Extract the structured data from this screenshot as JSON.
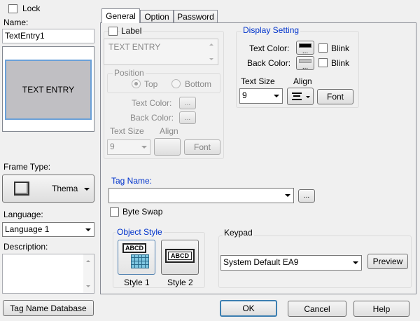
{
  "left": {
    "lock_label": "Lock",
    "name_label": "Name:",
    "name_value": "TextEntry1",
    "preview_text": "TEXT ENTRY",
    "frame_type_label": "Frame Type:",
    "frame_type_value": "Thema",
    "language_label": "Language:",
    "language_value": "Language 1",
    "description_label": "Description:",
    "tag_db_button": "Tag Name Database"
  },
  "tabs": [
    {
      "label": "General"
    },
    {
      "label": "Option"
    },
    {
      "label": "Password"
    }
  ],
  "label_group": {
    "label_checkbox": "Label",
    "label_text": "TEXT ENTRY",
    "position_title": "Position",
    "position_top": "Top",
    "position_bottom": "Bottom",
    "text_color_label": "Text Color:",
    "back_color_label": "Back Color:",
    "ellipsis": "...",
    "text_size_label": "Text Size",
    "align_label": "Align",
    "text_size_value": "9",
    "font_button": "Font"
  },
  "display_setting": {
    "title": "Display Setting",
    "text_color_label": "Text Color:",
    "back_color_label": "Back Color:",
    "blink_label": "Blink",
    "text_size_label": "Text Size",
    "align_label": "Align",
    "text_size_value": "9",
    "font_button": "Font",
    "text_color": "#000000",
    "back_color": "#c0c0c0"
  },
  "tag": {
    "tag_name_label": "Tag Name:",
    "tag_name_value": "",
    "browse_button": "...",
    "byte_swap_label": "Byte Swap"
  },
  "object_style": {
    "title": "Object Style",
    "style1_label": "Style 1",
    "style2_label": "Style 2",
    "icon_text": "ABCD"
  },
  "keypad": {
    "title": "Keypad",
    "value": "System Default EA9",
    "preview_button": "Preview"
  },
  "footer": {
    "ok": "OK",
    "cancel": "Cancel",
    "help": "Help"
  },
  "colors": {
    "group_title_blue": "#0033cc",
    "preview_face": "#c0bfc3",
    "selection_border": "#6aa0d8"
  }
}
